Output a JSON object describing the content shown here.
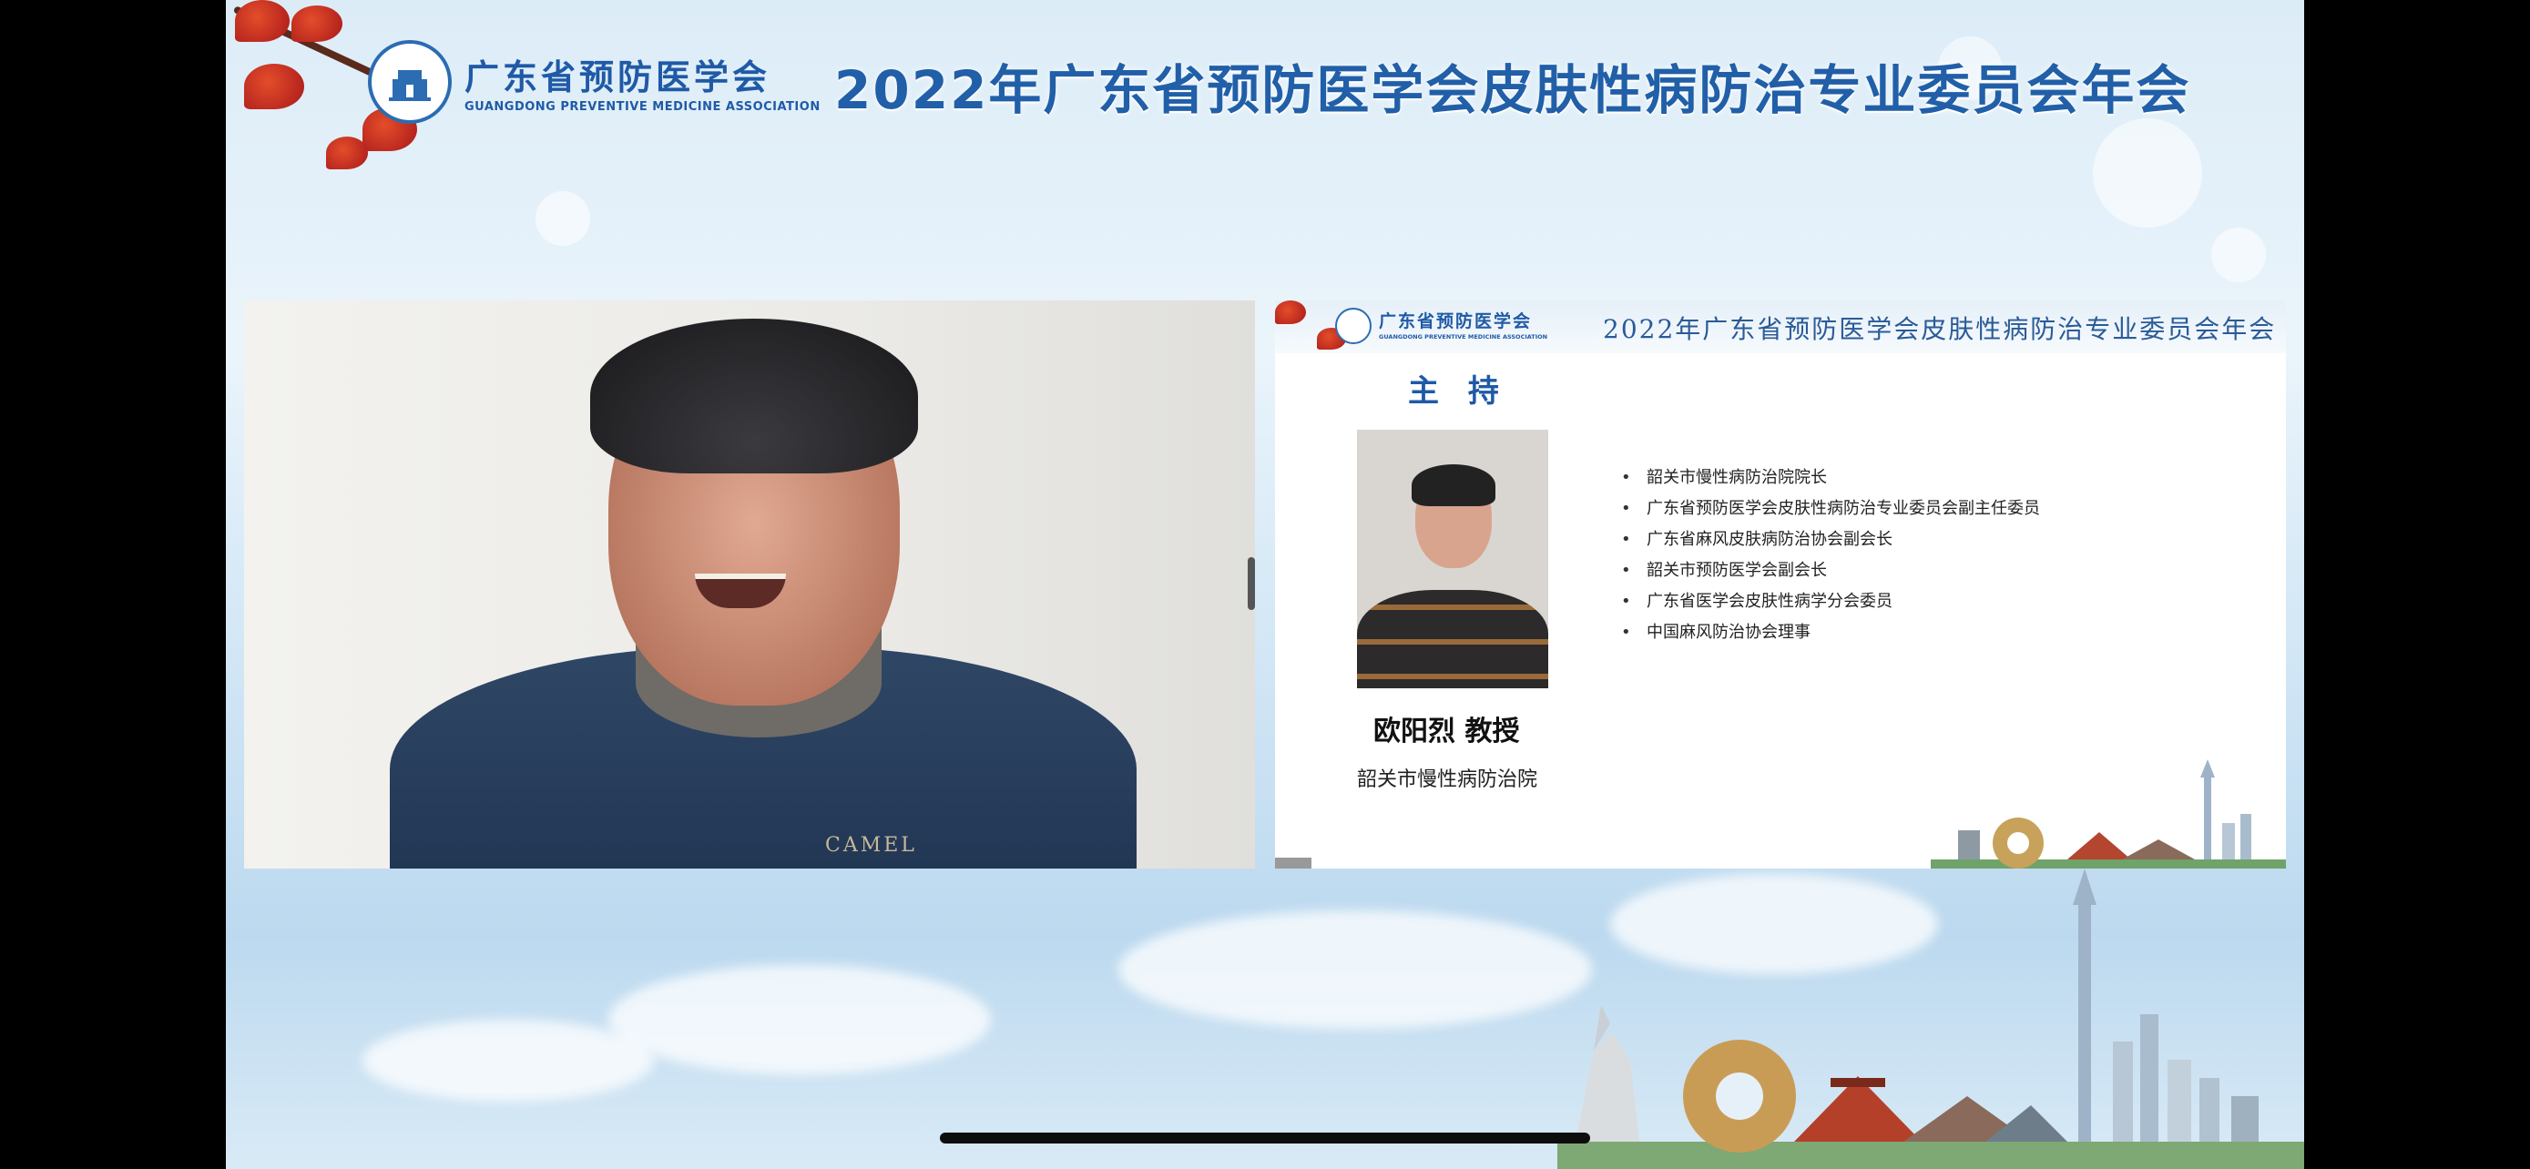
{
  "header": {
    "logo_badge": "GDPMA",
    "logo_cn": "广东省预防医学会",
    "logo_en": "GUANGDONG PREVENTIVE MEDICINE ASSOCIATION",
    "title": "2022年广东省预防医学会皮肤性病防治专业委员会年会"
  },
  "video": {
    "shirt_brand": "CAMEL"
  },
  "slide": {
    "header_logo_cn": "广东省预防医学会",
    "header_logo_en": "GUANGDONG PREVENTIVE MEDICINE ASSOCIATION",
    "header_title": "2022年广东省预防医学会皮肤性病防治专业委员会年会",
    "role": "主 持",
    "name": "欧阳烈 教授",
    "organization": "韶关市慢性病防治院",
    "bullets": [
      "韶关市慢性病防治院院长",
      "广东省预防医学会皮肤性病防治专业委员会副主任委员",
      "广东省麻风皮肤病防治协会副会长",
      "韶关市预防医学会副会长",
      "广东省医学会皮肤性病学分会委员",
      "中国麻风防治协会理事"
    ]
  },
  "colors": {
    "brand_blue": "#1f5aa6",
    "title_blue": "#215fa8",
    "background": "#dcecf7"
  }
}
